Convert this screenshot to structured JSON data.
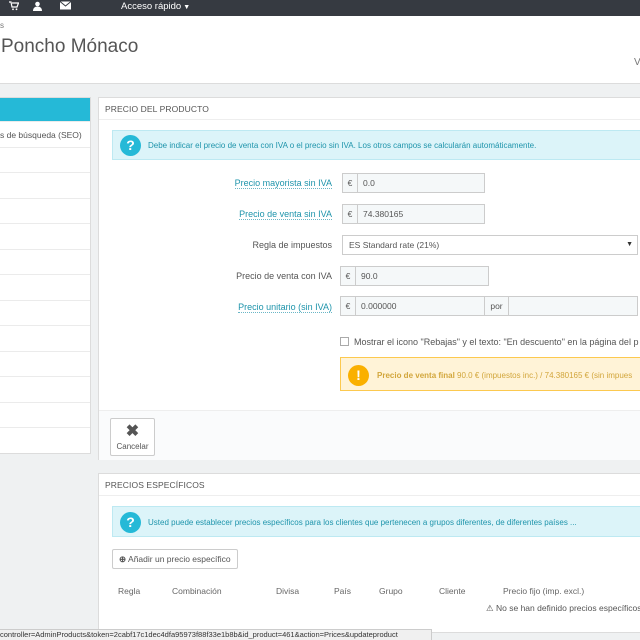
{
  "topbar": {
    "icons": [
      "cart-icon",
      "user-icon",
      "envelope-icon"
    ],
    "quick_access": "Acceso rápido"
  },
  "header": {
    "breadcrumb": "s",
    "title": "Poncho Mónaco",
    "right_fragment": "V"
  },
  "left_tabs": [
    {
      "label": "",
      "active": true
    },
    {
      "label": "s de búsqueda (SEO)",
      "active": false
    },
    {
      "label": "",
      "active": false
    },
    {
      "label": "",
      "active": false
    },
    {
      "label": "",
      "active": false
    },
    {
      "label": "",
      "active": false
    },
    {
      "label": "",
      "active": false
    },
    {
      "label": "",
      "active": false
    },
    {
      "label": "",
      "active": false
    },
    {
      "label": "",
      "active": false
    },
    {
      "label": "",
      "active": false
    },
    {
      "label": "",
      "active": false
    },
    {
      "label": "",
      "active": false
    }
  ],
  "price_panel": {
    "heading": "PRECIO DEL PRODUCTO",
    "info": "Debe indicar el precio de venta con IVA o el precio sin IVA. Los otros campos se calcularán automáticamente.",
    "fields": {
      "wholesale": {
        "label": "Precio mayorista sin IVA",
        "currency": "€",
        "value": "0.0"
      },
      "retail_excl": {
        "label": "Precio de venta sin IVA",
        "currency": "€",
        "value": "74.380165"
      },
      "tax_rule": {
        "label": "Regla de impuestos",
        "value": "ES Standard rate (21%)"
      },
      "retail_incl": {
        "label": "Precio de venta con IVA",
        "currency": "€",
        "value": "90.0"
      },
      "unit_price": {
        "label": "Precio unitario (sin IVA)",
        "currency": "€",
        "value": "0.000000",
        "per": "por",
        "unit": ""
      }
    },
    "on_sale_checkbox": "Mostrar el icono \"Rebajas\" y el texto: \"En descuento\" en la página del p",
    "final_price_bold": "Precio de venta final",
    "final_price_rest": " 90.0 € (impuestos inc.) / 74.380165 € (sin impues",
    "cancel_label": "Cancelar"
  },
  "specific_panel": {
    "heading": "PRECIOS ESPECÍFICOS",
    "info": "Usted puede establecer precios específicos para los clientes que pertenecen a grupos diferentes, de diferentes países ...",
    "add_button": "Añadir un precio específico",
    "columns": [
      "Regla",
      "Combinación",
      "Divisa",
      "País",
      "Grupo",
      "Cliente",
      "Precio fijo (imp. excl.)"
    ],
    "no_results": "No se han definido precios específicos"
  },
  "statusbar": {
    "url": "controller=AdminProducts&token=2cabf17c1dec4dfa95973f88f33e1b8b&id_product=461&action=Prices&updateproduct"
  }
}
